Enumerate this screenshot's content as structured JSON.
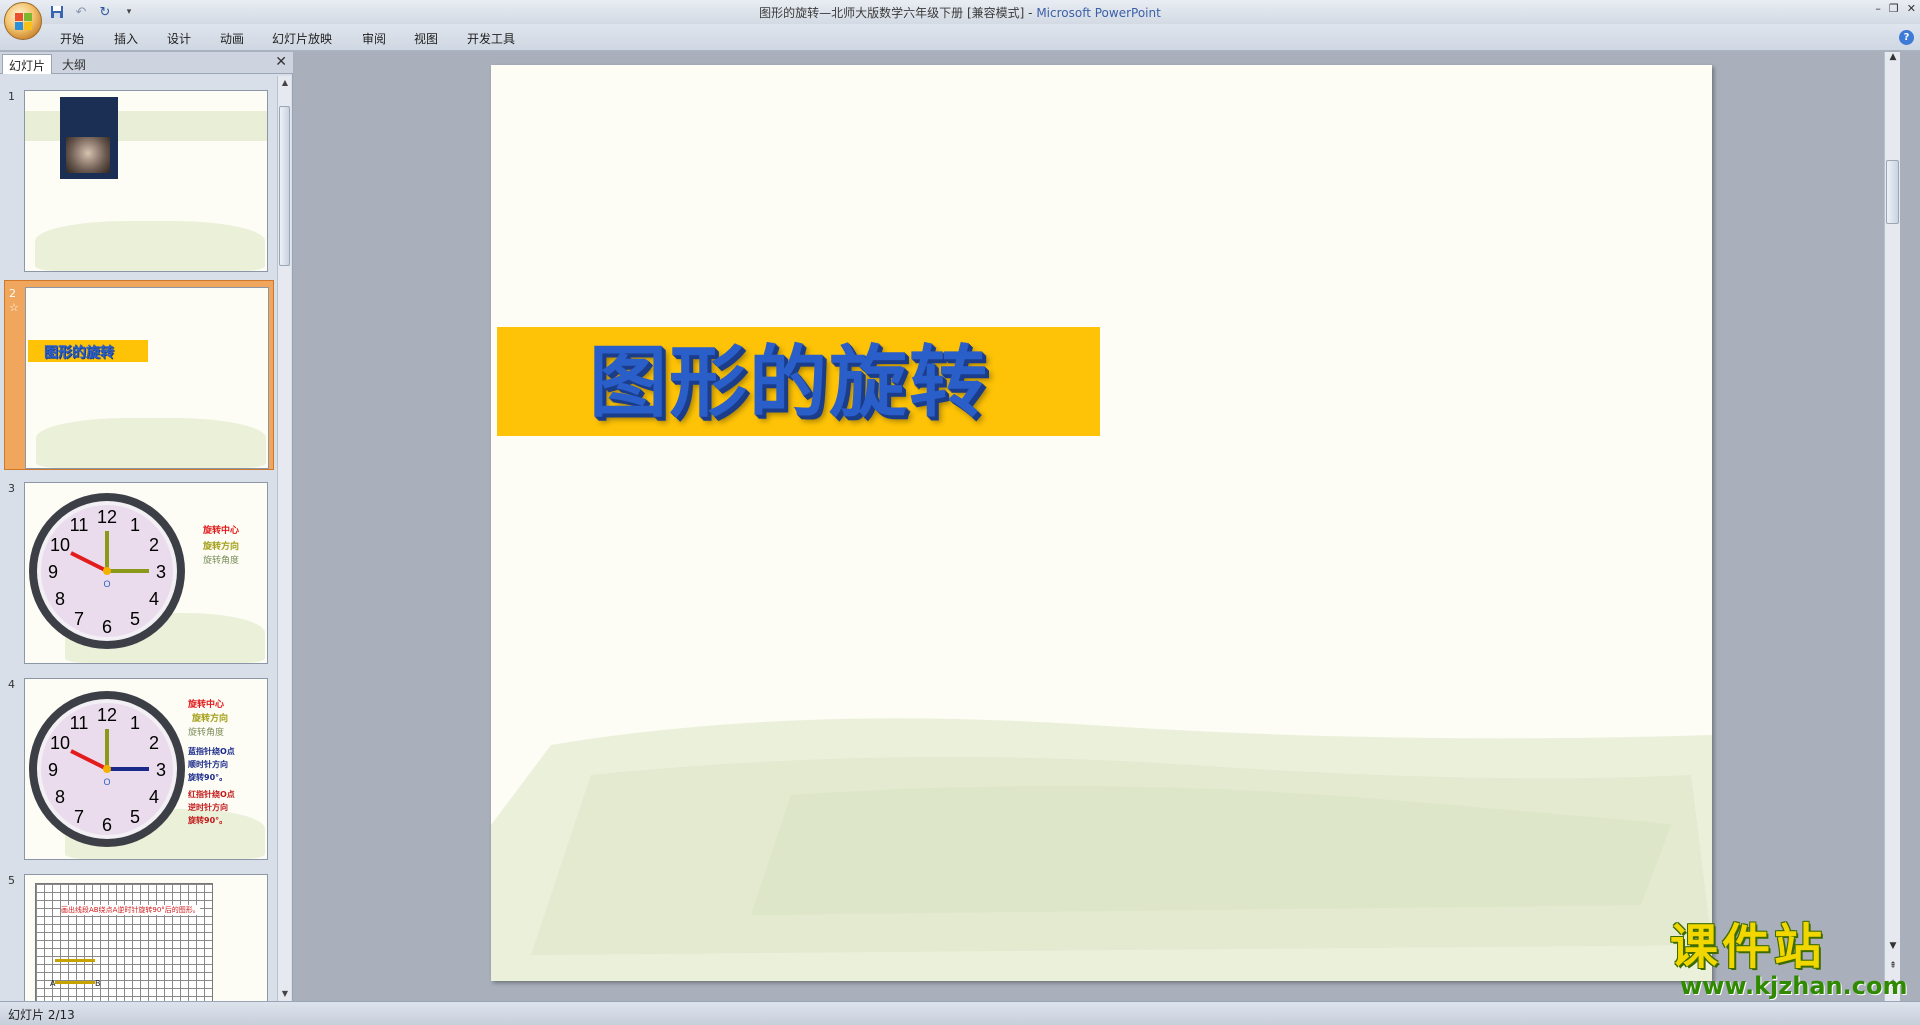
{
  "window": {
    "title": "图形的旋转—北师大版数学六年级下册 [兼容模式] - ",
    "app_name": "Microsoft PowerPoint",
    "controls": [
      "–",
      "❐",
      "✕"
    ]
  },
  "ribbon": {
    "tabs": [
      "开始",
      "插入",
      "设计",
      "动画",
      "幻灯片放映",
      "审阅",
      "视图",
      "开发工具"
    ]
  },
  "left_pane": {
    "tabs": [
      "幻灯片",
      "大纲"
    ],
    "slides": [
      {
        "number": "1"
      },
      {
        "number": "2",
        "anim_marker": "☆",
        "title": "图形的旋转"
      },
      {
        "number": "3",
        "labels": [
          "旋转中心",
          "旋转方向",
          "旋转角度"
        ]
      },
      {
        "number": "4",
        "labels": [
          "旋转中心",
          "旋转方向",
          "旋转角度",
          "蓝指针绕O点",
          "顺时针方向",
          "旋转90°。",
          "红指针绕O点",
          "逆时针方向",
          "旋转90°。"
        ]
      },
      {
        "number": "5",
        "grid_text": "画出线段AB绕点A逆时针旋转90°后的图形。",
        "point_a": "A",
        "point_b": "B"
      }
    ],
    "clock_numbers": [
      "12",
      "1",
      "2",
      "3",
      "4",
      "5",
      "6",
      "7",
      "8",
      "9",
      "10",
      "11"
    ],
    "clock_center": "O"
  },
  "main_slide": {
    "title": "图形的旋转",
    "banner_color": "#FEC306",
    "title_color": "#2A5FC9"
  },
  "watermark": {
    "title": "课件站",
    "url": "www.kjzhan.com"
  },
  "status": {
    "slide_info": "幻灯片 2/13"
  }
}
